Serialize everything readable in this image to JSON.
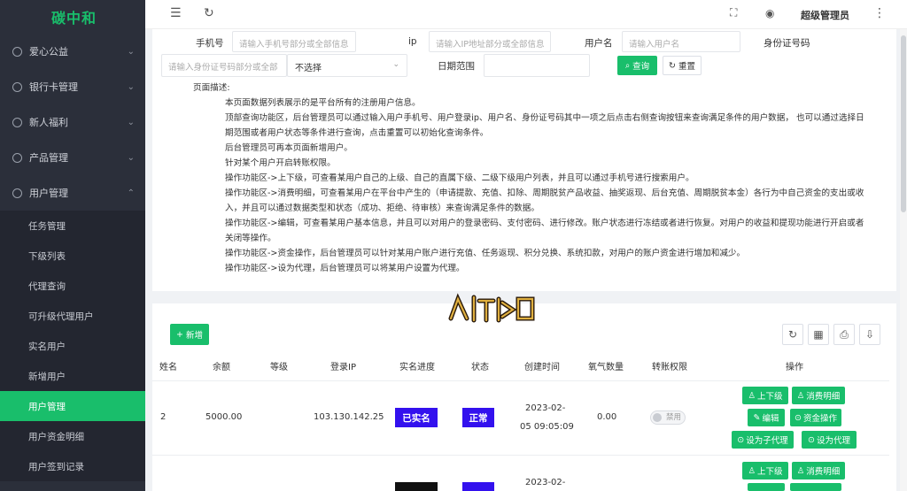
{
  "app": {
    "logo": "碳中和"
  },
  "sidebar": {
    "menus": [
      {
        "label": "爱心公益",
        "chevron": "⌄"
      },
      {
        "label": "银行卡管理",
        "chevron": "⌄"
      },
      {
        "label": "新人福利",
        "chevron": "⌄"
      },
      {
        "label": "产品管理",
        "chevron": "⌄"
      },
      {
        "label": "用户管理",
        "chevron": "⌃"
      }
    ],
    "sub_items": [
      "任务管理",
      "下级列表",
      "代理查询",
      "可升级代理用户",
      "实名用户",
      "新增用户",
      "用户管理",
      "用户资金明细",
      "用户签到记录"
    ],
    "active": "用户管理"
  },
  "header": {
    "collapse_icon": "☰",
    "refresh_icon": "↻",
    "fullscreen_icon": "⛶",
    "globe_icon": "◉",
    "user_name": "超级管理员",
    "more_icon": "⋮"
  },
  "search": {
    "phone_label": "手机号",
    "phone_placeholder": "请输入手机号部分或全部信息",
    "ip_label": "ip",
    "ip_placeholder": "请输入IP地址部分或全部信息",
    "username_label": "用户名",
    "username_placeholder": "请输入用户名",
    "idcard_label": "身份证号码",
    "idcard_placeholder": "请输入身份证号码部分或全部",
    "select_value": "不选择",
    "date_label": "日期范围",
    "query_button": "查询",
    "reset_button": "重置"
  },
  "description": {
    "title": "页面描述:",
    "lines": [
      "本页面数据列表展示的是平台所有的注册用户信息。",
      "顶部查询功能区，后台管理员可以通过输入用户手机号、用户登录ip、用户名、身份证号码其中一项之后点击右侧查询按钮来查询满足条件的用户数据，  也可以通过选择日",
      "期范围或者用户状态等条件进行查询，点击重置可以初始化查询条件。",
      "后台管理员可再本页面新增用户。",
      "针对某个用户开启转账权限。",
      "操作功能区->上下级，可查看某用户自己的上级、自己的直属下级、二级下级用户列表，并且可以通过手机号进行搜索用户。",
      "操作功能区->消费明细，可查看某用户在平台中产生的（申请提款、充值、扣除、周期脱贫产品收益、抽奖返现、后台充值、周期脱贫本金）各行为中自己资金的支出或收",
      "入，并且可以通过数据类型和状态（成功、拒绝、待审核）来查询满足条件的数据。",
      "操作功能区->编辑，可查看某用户基本信息，并且可以对用户的登录密码、支付密码、进行修改。账户状态进行冻结或者进行恢复。对用户的收益和提现功能进行开启或者",
      "关闭等操作。",
      "操作功能区->资金操作，后台管理员可以针对某用户账户进行充值、任务返现、积分兑换、系统扣款，对用户的账户资金进行增加和减少。",
      "操作功能区->设为代理，后台管理员可以将某用户设置为代理。"
    ]
  },
  "toolbar": {
    "add_button": "新增"
  },
  "table": {
    "headers": [
      "姓名",
      "余额",
      "等级",
      "登录IP",
      "实名进度",
      "状态",
      "创建时间",
      "氧气数量",
      "转账权限",
      "操作"
    ],
    "rows": [
      {
        "id": "2",
        "balance": "5000.00",
        "level": "",
        "ip": "103.130.142.25",
        "verify": "已实名",
        "status": "正常",
        "created_date": "2023-02-",
        "created_time": "05 09:05:09",
        "oxygen": "0.00",
        "transfer": "禁用"
      }
    ],
    "ops": [
      "上下级",
      "消费明细",
      "编辑",
      "资金操作",
      "设为子代理",
      "设为代理"
    ],
    "row2": {
      "created_date": "2023-02-"
    }
  },
  "colors": {
    "accent": "#19be6b",
    "sidebar_bg": "#2b2f3a",
    "tag_purple": "#3311ee"
  }
}
